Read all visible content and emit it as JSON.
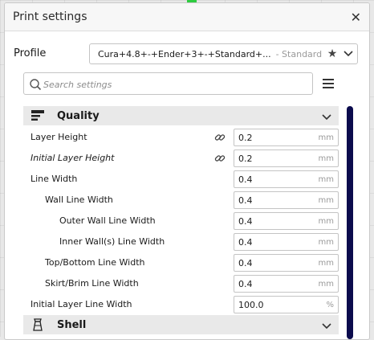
{
  "colors": {
    "accent": "#2ecc40",
    "scrollbar": "#0b0b4d"
  },
  "dialog": {
    "title": "Print settings"
  },
  "profile": {
    "label": "Profile",
    "name": "Cura+4.8+-+Ender+3+-+Standard+...",
    "suffix": "- Standard Q..."
  },
  "search": {
    "placeholder": "Search settings"
  },
  "sections": [
    {
      "title": "Quality",
      "icon": "quality-icon"
    },
    {
      "title": "Shell",
      "icon": "shell-icon"
    }
  ],
  "settings": [
    {
      "label": "Layer Height",
      "value": "0.2",
      "unit": "mm",
      "italic": false,
      "link": true
    },
    {
      "label": "Initial Layer Height",
      "value": "0.2",
      "unit": "mm",
      "italic": true,
      "link": true
    },
    {
      "label": "Line Width",
      "value": "0.4",
      "unit": "mm",
      "italic": false,
      "link": false
    },
    {
      "label": "Wall Line Width",
      "value": "0.4",
      "unit": "mm",
      "italic": false,
      "link": false
    },
    {
      "label": "Outer Wall Line Width",
      "value": "0.4",
      "unit": "mm",
      "italic": false,
      "link": false
    },
    {
      "label": "Inner Wall(s) Line Width",
      "value": "0.4",
      "unit": "mm",
      "italic": false,
      "link": false
    },
    {
      "label": "Top/Bottom Line Width",
      "value": "0.4",
      "unit": "mm",
      "italic": false,
      "link": false
    },
    {
      "label": "Skirt/Brim Line Width",
      "value": "0.4",
      "unit": "mm",
      "italic": false,
      "link": false
    },
    {
      "label": "Initial Layer Line Width",
      "value": "100.0",
      "unit": "%",
      "italic": false,
      "link": false
    }
  ]
}
